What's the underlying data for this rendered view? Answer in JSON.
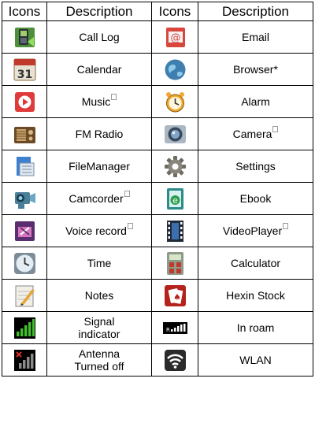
{
  "headers": [
    "Icons",
    "Description",
    "Icons",
    "Description"
  ],
  "rows": [
    {
      "left": {
        "icon": "call-log-icon",
        "label": "Call Log"
      },
      "right": {
        "icon": "email-icon",
        "label": "Email"
      }
    },
    {
      "left": {
        "icon": "calendar-icon",
        "label": "Calendar",
        "icon_text": "31"
      },
      "right": {
        "icon": "browser-icon",
        "label": "Browser*"
      }
    },
    {
      "left": {
        "icon": "music-icon",
        "label": "Music"
      },
      "right": {
        "icon": "alarm-icon",
        "label": "Alarm"
      }
    },
    {
      "left": {
        "icon": "fm-radio-icon",
        "label": "FM Radio"
      },
      "right": {
        "icon": "camera-icon",
        "label": "Camera"
      }
    },
    {
      "left": {
        "icon": "file-manager-icon",
        "label": "FileManager"
      },
      "right": {
        "icon": "settings-icon",
        "label": "Settings"
      }
    },
    {
      "left": {
        "icon": "camcorder-icon",
        "label": "Camcorder"
      },
      "right": {
        "icon": "ebook-icon",
        "label": "Ebook",
        "icon_text": "e"
      }
    },
    {
      "left": {
        "icon": "voice-record-icon",
        "label": "Voice record"
      },
      "right": {
        "icon": "video-player-icon",
        "label": "VideoPlayer"
      }
    },
    {
      "left": {
        "icon": "time-icon",
        "label": "Time"
      },
      "right": {
        "icon": "calculator-icon",
        "label": "Calculator"
      }
    },
    {
      "left": {
        "icon": "notes-icon",
        "label": "Notes"
      },
      "right": {
        "icon": "hexin-stock-icon",
        "label": "Hexin Stock"
      }
    },
    {
      "left": {
        "icon": "signal-indicator-icon",
        "label_lines": [
          "Signal",
          "indicator"
        ]
      },
      "right": {
        "icon": "in-roam-icon",
        "label": "In roam"
      }
    },
    {
      "left": {
        "icon": "antenna-off-icon",
        "label_lines": [
          "Antenna",
          "Turned off"
        ]
      },
      "right": {
        "icon": "wlan-icon",
        "label": "WLAN"
      }
    }
  ],
  "colors": {
    "border": "#000000",
    "footnote_box": "#9a9a9a"
  }
}
